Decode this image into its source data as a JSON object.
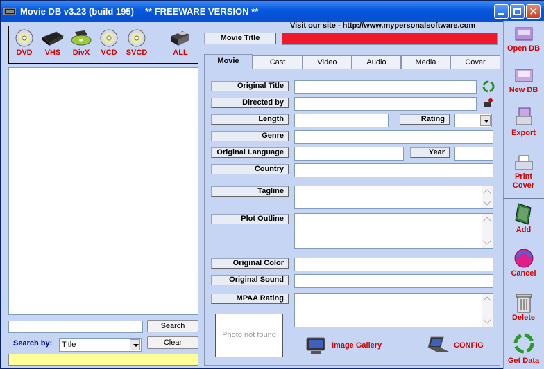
{
  "window": {
    "title": "Movie DB v3.23 (build 195)",
    "subtitle": "** FREEWARE VERSION **"
  },
  "media_types": [
    {
      "label": "DVD",
      "icon": "dvd-disc-icon"
    },
    {
      "label": "VHS",
      "icon": "vhs-tape-icon"
    },
    {
      "label": "DivX",
      "icon": "divx-disc-icon"
    },
    {
      "label": "VCD",
      "icon": "vcd-disc-icon"
    },
    {
      "label": "SVCD",
      "icon": "svcd-disc-icon"
    },
    {
      "label": "ALL",
      "icon": "all-media-icon"
    }
  ],
  "search": {
    "button": "Search",
    "clear": "Clear",
    "search_by_label": "Search by:",
    "search_by_value": "Title"
  },
  "header": {
    "visit": "Visit our site - http://www.mypersonalsoftware.com",
    "movie_title_label": "Movie Title"
  },
  "tabs": [
    "Movie",
    "Cast",
    "Video",
    "Audio",
    "Media",
    "Cover"
  ],
  "form": {
    "original_title": "Original Title",
    "directed_by": "Directed by",
    "length": "Length",
    "rating": "Rating",
    "genre": "Genre",
    "original_language": "Original Language",
    "year": "Year",
    "country": "Country",
    "tagline": "Tagline",
    "plot_outline": "Plot Outline",
    "original_color": "Original Color",
    "original_sound": "Original Sound",
    "mpaa_rating": "MPAA Rating"
  },
  "photo": {
    "placeholder": "Photo not found"
  },
  "actions": {
    "image_gallery": "Image Gallery",
    "config": "CONFIG"
  },
  "sidebar": {
    "open_db": "Open DB",
    "new_db": "New DB",
    "export": "Export",
    "print_cover_1": "Print",
    "print_cover_2": "Cover",
    "add": "Add",
    "cancel": "Cancel",
    "delete": "Delete",
    "get_data": "Get Data"
  },
  "colors": {
    "window_bg": "#c7d5f5",
    "title_field": "#f0182a",
    "accent_red": "#d00000",
    "status_yellow": "#ffff99"
  }
}
